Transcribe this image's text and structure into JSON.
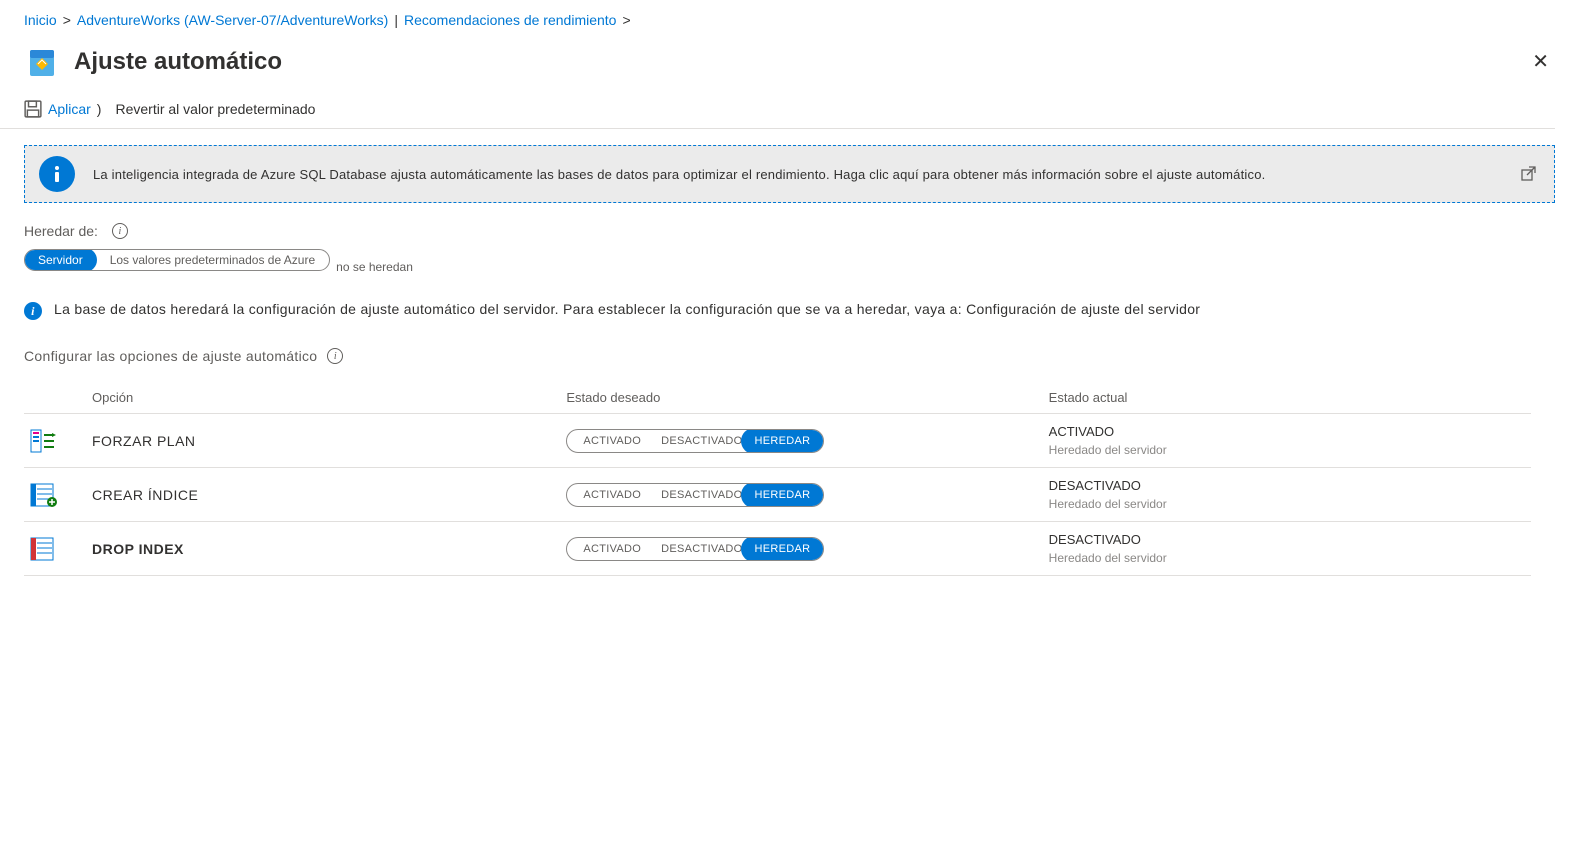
{
  "breadcrumb": {
    "home": "Inicio",
    "item1": "AdventureWorks (AW-Server-07/AdventureWorks)",
    "pipe": " | ",
    "item2": "Recomendaciones de rendimiento"
  },
  "header": {
    "title": "Ajuste automático"
  },
  "toolbar": {
    "apply": "Aplicar",
    "revert": "Revertir al valor predeterminado"
  },
  "banner": {
    "text": "La inteligencia integrada de Azure SQL Database ajusta automáticamente las bases de datos para optimizar el rendimiento. Haga clic aquí para obtener más información sobre el ajuste automático."
  },
  "inherit": {
    "label": "Heredar de:",
    "server": "Servidor",
    "azure_defaults": "Los valores predeterminados de Azure",
    "no_inherit": "no se heredan",
    "note": "La base de datos heredará la configuración de ajuste automático del servidor. Para establecer la configuración que se va a heredar, vaya a: Configuración de ajuste del servidor"
  },
  "config_section_label": "Configurar las opciones de ajuste automático",
  "table": {
    "headers": {
      "option": "Opción",
      "desired": "Estado deseado",
      "current": "Estado actual"
    },
    "toggle": {
      "on": "ACTIVADO",
      "off": "DESACTIVADO",
      "inherit": "HEREDAR"
    },
    "rows": [
      {
        "name": "FORZAR PLAN",
        "bold": false,
        "state_main": "ACTIVADO",
        "state_sub": "Heredado del servidor"
      },
      {
        "name": "CREAR ÍNDICE",
        "bold": false,
        "state_main": "DESACTIVADO",
        "state_sub": "Heredado del servidor"
      },
      {
        "name": "DROP INDEX",
        "bold": true,
        "state_main": "DESACTIVADO",
        "state_sub": "Heredado del servidor"
      }
    ]
  }
}
